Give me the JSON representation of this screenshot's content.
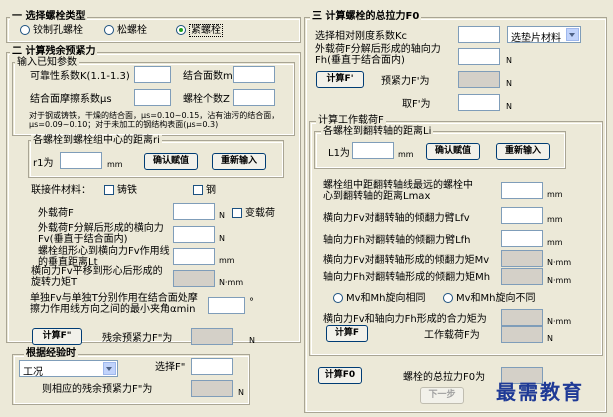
{
  "left": {
    "bolt_type": {
      "title": "选择螺栓类型",
      "options": [
        "铰制孔螺栓",
        "松螺栓",
        "紧螺栓"
      ],
      "selected": "紧螺栓"
    },
    "preload": {
      "title": "计算残余预紧力",
      "known_data": {
        "title": "输入已知参数",
        "reliability_label": "可靠性系数K(1.1-1.3)",
        "joint_count_label": "结合面数m",
        "friction_label": "结合面摩擦系数μs",
        "bolt_count_label": "螺栓个数Z",
        "note": "对于钢或铸铁，干燥的结合面，μs=0.10~0.15，沾有油污的结合面，μs=0.09~0.10；对于未加工的钢结构表面(μs=0.3)"
      },
      "ri_group": {
        "title": "各螺栓到螺栓组中心的距离ri",
        "r1_label": "r1为",
        "unit": "mm",
        "confirm_button": "确认赋值",
        "reinput_button": "重新输入"
      },
      "material_label": "联接件材料：",
      "cast_iron_label": "铸铁",
      "steel_label": "钢",
      "external_load_label": "外载荷F",
      "external_load_unit": "N",
      "variable_load_label": "变载荷",
      "fv_label": "外载荷F分解后形成的横向力Fv(垂直于结合面内)",
      "fv_unit": "N",
      "lt_label": "螺栓组形心到横向力Fv作用线的垂直距离Lt",
      "lt_unit": "mm",
      "torque_label": "横向力Fv平移到形心后形成的旋转力矩T",
      "torque_unit": "N·mm",
      "angle_label": "单独Fv与单独T分别作用在结合面处摩擦力作用线方向之间的最小夹角αmin",
      "angle_unit": "°",
      "calc_button": "计算F\"",
      "residual_label": "残余预紧力F\"为",
      "residual_unit": "N"
    },
    "empirical": {
      "title": "根据经验时",
      "condition_value": "工况",
      "select_label": "选择F\"",
      "result_label": "则相应的残余预紧力F\"为",
      "result_unit": "N"
    }
  },
  "right": {
    "tension": {
      "title": "计算螺栓的总拉力F0",
      "stiffness_label": "选择相对刚度系数Kc",
      "stiffness_select": "选垫片材料",
      "fh_label": "外载荷F分解后形成的轴向力Fh(垂直于结合面内)",
      "fh_unit": "N",
      "calc_f_button": "计算F'",
      "preload_label": "预紧力F'为",
      "preload_unit": "N",
      "take_label": "取F'为",
      "take_unit": "N"
    },
    "working_load": {
      "title": "计算工作载荷F",
      "li_group": {
        "title": "各螺栓到翻转轴的距离Li",
        "l1_label": "L1为",
        "unit": "mm",
        "confirm_button": "确认赋值",
        "reinput_button": "重新输入"
      },
      "lmax_label": "螺栓组中距翻转轴线最远的螺栓中心到翻转轴的距离Lmax",
      "lmax_unit": "mm",
      "lfv_label": "横向力Fv对翻转轴的倾翻力臂Lfv",
      "lfv_unit": "mm",
      "lfh_label": "轴向力Fh对翻转轴的倾翻力臂Lfh",
      "lfh_unit": "mm",
      "mv_label": "横向力Fv对翻转轴形成的倾翻力矩Mv",
      "mv_unit": "N·mm",
      "mh_label": "轴向力Fh对翻转轴形成的倾翻力矩Mh",
      "mh_unit": "N·mm",
      "same_dir_label": "Mv和Mh旋向相同",
      "diff_dir_label": "Mv和Mh旋向不同",
      "resultant_label": "横向力Fv和轴向力Fh形成的合力矩为",
      "resultant_unit": "N·mm",
      "calc_f_button": "计算F",
      "work_load_label": "工作载荷F为",
      "work_load_unit": "N"
    },
    "calc_f0_button": "计算F0",
    "total_label": "螺栓的总拉力F0为",
    "next_button": "下一步"
  },
  "watermark": "最需教育"
}
